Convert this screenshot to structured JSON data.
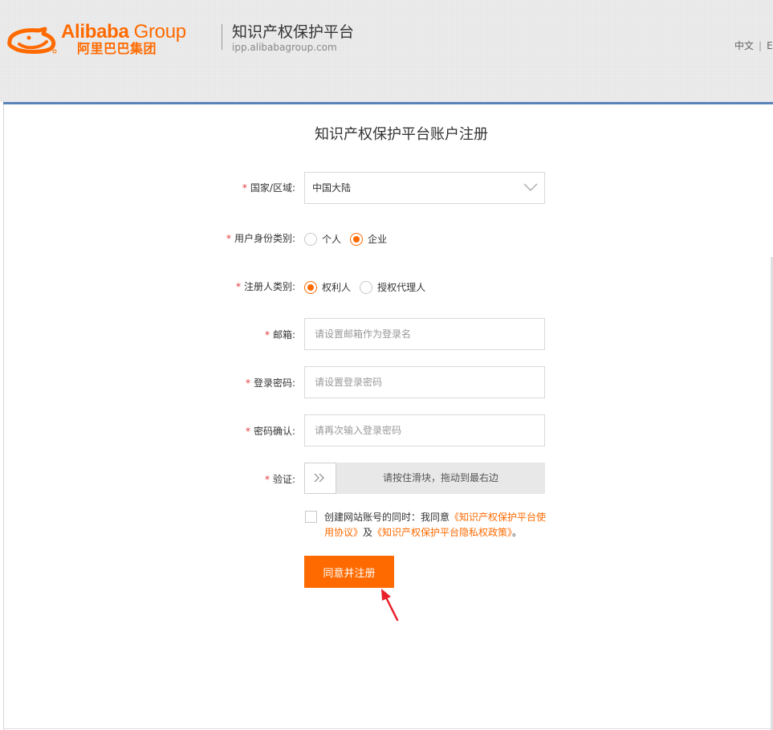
{
  "header": {
    "logo_en": "Alibaba",
    "logo_group": "Group",
    "logo_cn": "阿里巴巴集团",
    "platform_title": "知识产权保护平台",
    "platform_url": "ipp.alibabagroup.com",
    "lang_cn": "中文",
    "lang_sep": "|",
    "lang_en": "En"
  },
  "form": {
    "title": "知识产权保护平台账户注册",
    "required_mark": "*",
    "country": {
      "label": "国家/区域:",
      "value": "中国大陆"
    },
    "identity": {
      "label": "用户身份类别:",
      "options": [
        "个人",
        "企业"
      ],
      "selected": "企业"
    },
    "registrant": {
      "label": "注册人类别:",
      "options": [
        "权利人",
        "授权代理人"
      ],
      "selected": "权利人"
    },
    "email": {
      "label": "邮箱:",
      "placeholder": "请设置邮箱作为登录名"
    },
    "password": {
      "label": "登录密码:",
      "placeholder": "请设置登录密码"
    },
    "confirm": {
      "label": "密码确认:",
      "placeholder": "请再次输入登录密码"
    },
    "verify": {
      "label": "验证:",
      "slider_text": "请按住滑块，拖动到最右边"
    },
    "agreement": {
      "text_prefix": "创建网站账号的同时：我同意",
      "link1": "《知识产权保护平台使用协议》",
      "text_and": "及",
      "link2": "《知识产权保护平台隐私权政策》",
      "text_suffix": "。",
      "checked": false
    },
    "submit_label": "同意并注册"
  },
  "colors": {
    "accent": "#ff6a00",
    "top_bar": "#5b82b8",
    "required": "#e4393c"
  },
  "icons": [
    "alibaba-smile-icon",
    "chevron-down-icon",
    "double-chevron-right-icon",
    "red-arrow-icon"
  ]
}
